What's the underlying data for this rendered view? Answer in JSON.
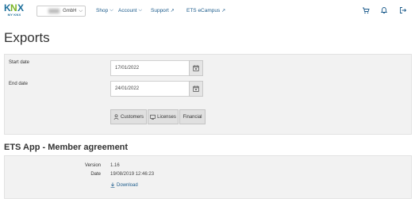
{
  "header": {
    "logo_text": "MY KNX",
    "company": {
      "value": "GmbH"
    },
    "nav": [
      {
        "label": "Shop"
      },
      {
        "label": "Account"
      },
      {
        "label": "Support"
      },
      {
        "label": "ETS eCampus"
      }
    ],
    "icons": [
      "cart-icon",
      "bell-icon",
      "logout-icon"
    ]
  },
  "page": {
    "title": "Exports"
  },
  "export_form": {
    "start_label": "Start date",
    "start_value": "17/01/2022",
    "end_label": "End date",
    "end_value": "24/01/2022",
    "buttons": {
      "customers": "Customers",
      "licenses": "Licenses",
      "financial": "Financial"
    }
  },
  "agreement": {
    "title": "ETS App - Member agreement",
    "version_label": "Version",
    "version_value": "1.16",
    "date_label": "Date",
    "date_value": "19/08/2019 12:46:23",
    "download_label": "Download"
  }
}
